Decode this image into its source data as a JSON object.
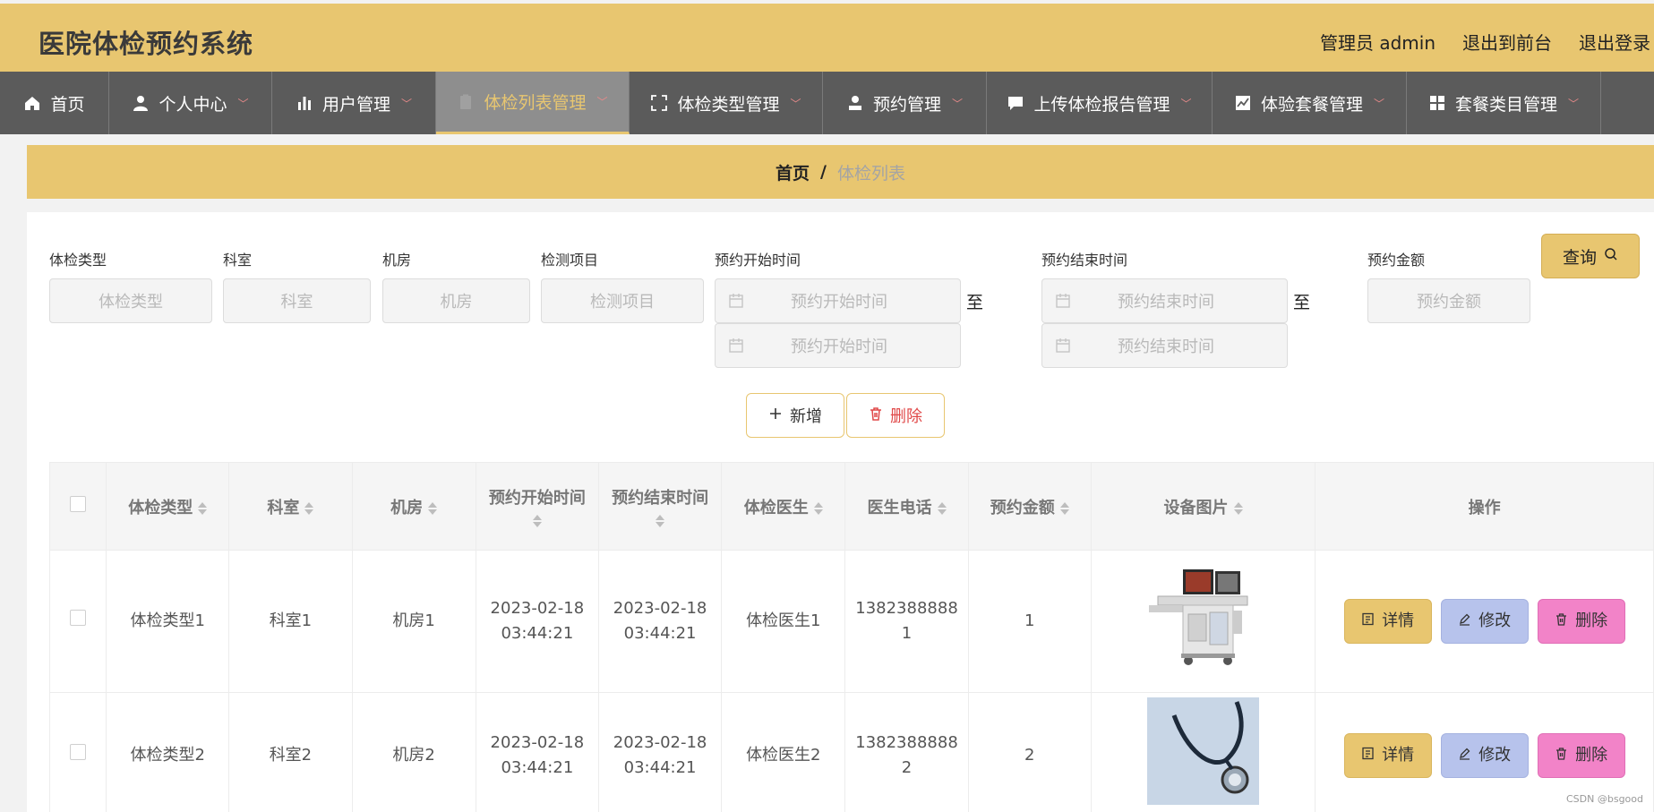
{
  "header": {
    "title": "医院体检预约系统",
    "admin": "管理员 admin",
    "front": "退出到前台",
    "logout": "退出登录"
  },
  "nav": [
    {
      "label": "首页",
      "icon": "home-icon",
      "dropdown": false,
      "active": false
    },
    {
      "label": "个人中心",
      "icon": "user-icon",
      "dropdown": true,
      "active": false
    },
    {
      "label": "用户管理",
      "icon": "bar-chart-icon",
      "dropdown": true,
      "active": false
    },
    {
      "label": "体检列表管理",
      "icon": "clipboard-icon",
      "dropdown": true,
      "active": true
    },
    {
      "label": "体检类型管理",
      "icon": "fullscreen-icon",
      "dropdown": true,
      "active": false
    },
    {
      "label": "预约管理",
      "icon": "person-icon",
      "dropdown": true,
      "active": false
    },
    {
      "label": "上传体检报告管理",
      "icon": "comment-icon",
      "dropdown": true,
      "active": false
    },
    {
      "label": "体验套餐管理",
      "icon": "line-chart-icon",
      "dropdown": true,
      "active": false
    },
    {
      "label": "套餐类目管理",
      "icon": "grid-icon",
      "dropdown": true,
      "active": false
    }
  ],
  "breadcrumb": {
    "home": "首页",
    "separator": "/",
    "current": "体检列表"
  },
  "search": {
    "type_label": "体检类型",
    "type_placeholder": "体检类型",
    "dept_label": "科室",
    "dept_placeholder": "科室",
    "room_label": "机房",
    "room_placeholder": "机房",
    "item_label": "检测项目",
    "item_placeholder": "检测项目",
    "start_label": "预约开始时间",
    "start_placeholder": "预约开始时间",
    "end_label": "预约结束时间",
    "end_placeholder": "预约结束时间",
    "to": "至",
    "amount_label": "预约金额",
    "amount_placeholder": "预约金额",
    "query": "查询"
  },
  "actions": {
    "add": "新增",
    "delete": "删除"
  },
  "table": {
    "headers": [
      "体检类型",
      "科室",
      "机房",
      "预约开始时间",
      "预约结束时间",
      "体检医生",
      "医生电话",
      "预约金额",
      "设备图片",
      "操作"
    ],
    "rows": [
      {
        "type": "体检类型1",
        "dept": "科室1",
        "room": "机房1",
        "start_date": "2023-02-18",
        "start_time": "03:44:21",
        "end_date": "2023-02-18",
        "end_time": "03:44:21",
        "doctor": "体检医生1",
        "phone_a": "1382388888",
        "phone_b": "1",
        "amount": "1",
        "image": "ultrasound-machine"
      },
      {
        "type": "体检类型2",
        "dept": "科室2",
        "room": "机房2",
        "start_date": "2023-02-18",
        "start_time": "03:44:21",
        "end_date": "2023-02-18",
        "end_time": "03:44:21",
        "doctor": "体检医生2",
        "phone_a": "1382388888",
        "phone_b": "2",
        "amount": "2",
        "image": "stethoscope"
      }
    ],
    "row_actions": {
      "detail": "详情",
      "edit": "修改",
      "delete": "删除"
    }
  },
  "watermark": "CSDN @bsgood"
}
